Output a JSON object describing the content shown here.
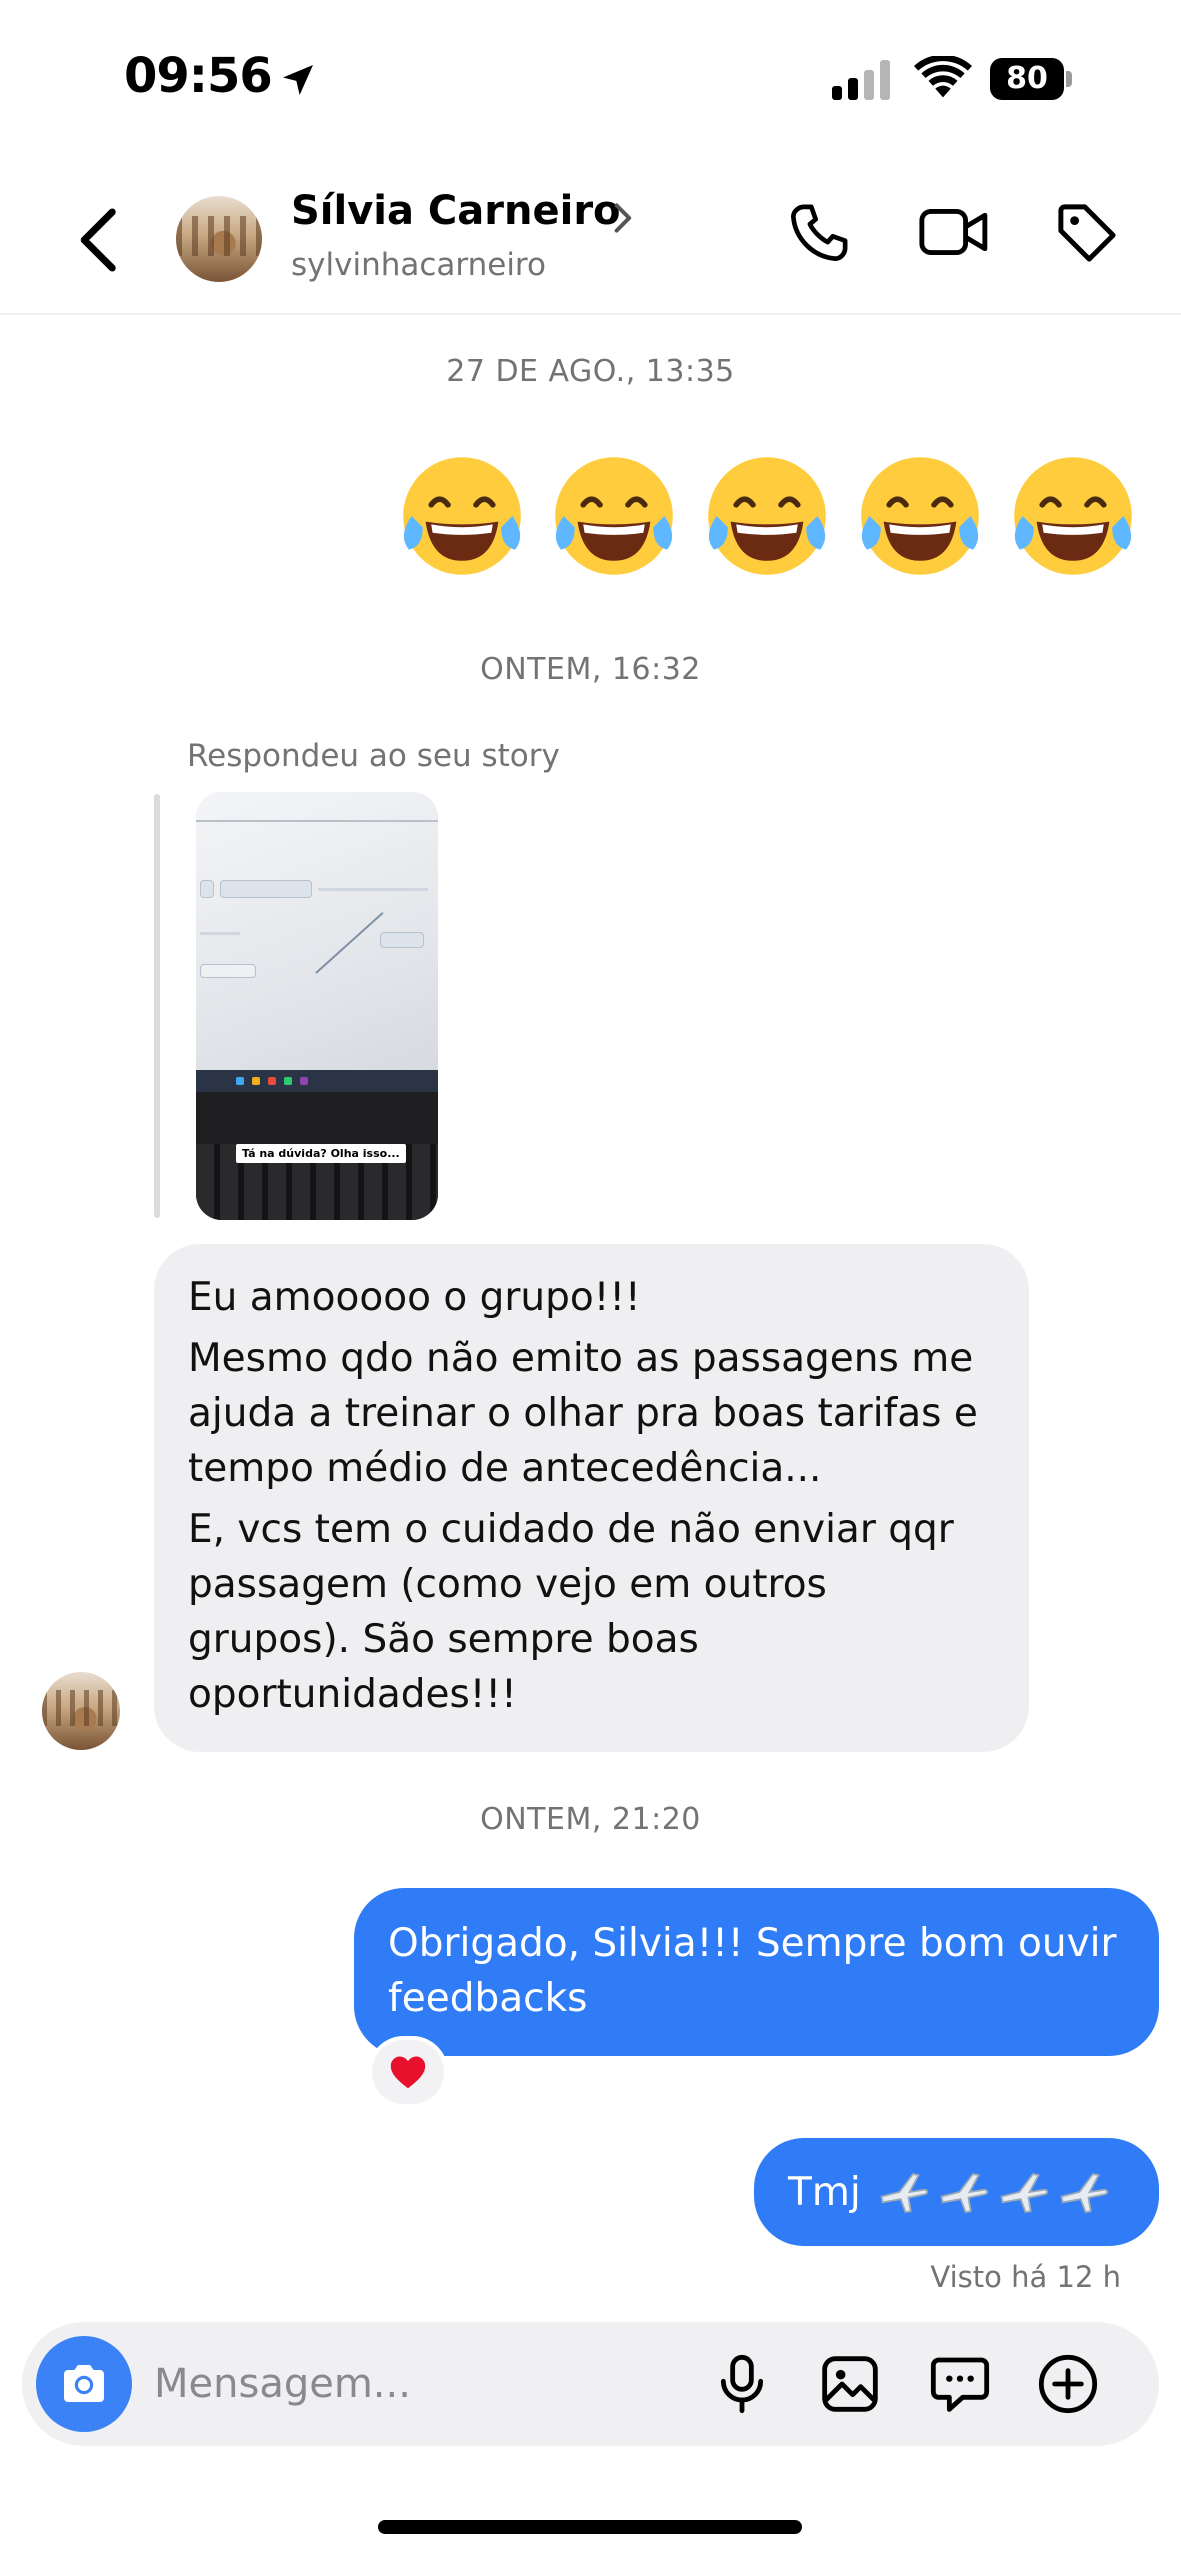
{
  "status_bar": {
    "time": "09:56",
    "battery": "80",
    "icons": [
      "location-arrow-icon",
      "cellular-signal-icon",
      "wifi-icon",
      "battery-icon"
    ]
  },
  "header": {
    "contact_name": "Sílvia Carneiro",
    "username": "sylvinhacarneiro",
    "icons": [
      "back-chevron-icon",
      "name-chevron-icon",
      "phone-icon",
      "video-camera-icon",
      "tag-icon"
    ]
  },
  "chat": {
    "timestamps": [
      "27 DE AGO., 13:35",
      "ONTEM, 16:32",
      "ONTEM, 21:20"
    ],
    "emoji_message": "😂😂😂😂😂",
    "story_reply_label": "Respondeu ao seu story",
    "story_caption": "Tá na dúvida? Olha isso...",
    "incoming_message": {
      "paragraphs": [
        "Eu amooooo o grupo!!!",
        "Mesmo qdo não emito as passagens me ajuda a treinar o olhar pra boas tarifas e tempo médio de antecedência...",
        "E, vcs tem o cuidado de não enviar qqr passagem (como vejo em outros grupos). São sempre boas oportunidades!!!"
      ]
    },
    "outgoing_message_1": "Obrigado, Silvia!!! Sempre bom ouvir feedbacks",
    "reaction": "❤️",
    "outgoing_message_2_text": "Tmj",
    "outgoing_message_2_emoji": "✈️✈️✈️✈️",
    "seen": "Visto há 12 h"
  },
  "composer": {
    "placeholder": "Mensagem...",
    "icons": [
      "camera-icon",
      "microphone-icon",
      "gallery-icon",
      "sticker-chat-icon",
      "add-icon"
    ]
  },
  "colors": {
    "outgoing_bubble": "#2f7cf6",
    "incoming_bubble": "#efeff1",
    "camera_button": "#3b82f6",
    "secondary_text": "#737373"
  }
}
